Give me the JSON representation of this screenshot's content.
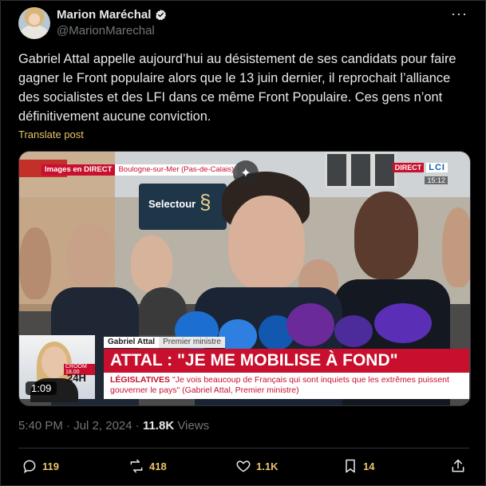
{
  "author": {
    "display_name": "Marion Maréchal",
    "handle": "@MarionMarechal",
    "verified": true
  },
  "post": {
    "text": "Gabriel Attal appelle aujourd’hui au désistement de ses candidats pour faire gagner le Front populaire alors que le 13 juin dernier, il reprochait l’alliance des socialistes et des LFI dans ce même Front Populaire. Ces gens n’ont définitivement aucune conviction.",
    "translate_label": "Translate post",
    "time": "5:40 PM",
    "separator": "·",
    "date": "Jul 2, 2024",
    "views_count": "11.8K",
    "views_label": "Views"
  },
  "video": {
    "live_label": "Images en DIRECT",
    "location": "Boulogne-sur-Mer (Pas-de-Calais)",
    "channel_direct": "DIRECT",
    "channel_logo": "LCI",
    "clock": "15:12",
    "store_sign": "Selectour",
    "speaker_name": "Gabriel Attal",
    "speaker_role": "Premier ministre",
    "headline": "ATTAL : \"JE ME MOBILISE À FOND\"",
    "sub_label": "LÉGISLATIVES",
    "sub_quote": "\"Je vois beaucoup de Français qui sont inquiets que les extrêmes puissent gouverner le pays\" (Gabriel Attal, Premier ministre)",
    "show_tag": "CROOM 18.00",
    "show_name": "24H",
    "duration": "1:09"
  },
  "actions": {
    "replies": "119",
    "reposts": "418",
    "likes": "1.1K",
    "bookmarks": "14"
  },
  "colors": {
    "accent_count": "#e9c46a",
    "muted": "#71767b",
    "verified_badge": "#e7e9ea",
    "lci_red": "#c8102e"
  }
}
